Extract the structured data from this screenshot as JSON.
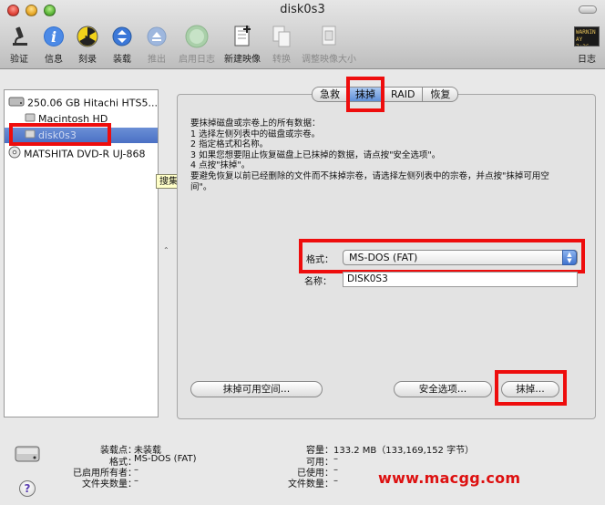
{
  "window": {
    "title": "disk0s3"
  },
  "toolbar": {
    "items": [
      {
        "label": "验证",
        "icon": "microscope-icon",
        "enabled": true
      },
      {
        "label": "信息",
        "icon": "info-icon",
        "enabled": true
      },
      {
        "label": "刻录",
        "icon": "burn-icon",
        "enabled": true
      },
      {
        "label": "装载",
        "icon": "mount-icon",
        "enabled": true
      },
      {
        "label": "推出",
        "icon": "eject-icon",
        "enabled": false
      },
      {
        "label": "启用日志",
        "icon": "journal-icon",
        "enabled": false
      },
      {
        "label": "新建映像",
        "icon": "new-image-icon",
        "enabled": true
      },
      {
        "label": "转换",
        "icon": "convert-icon",
        "enabled": false
      },
      {
        "label": "调整映像大小",
        "icon": "resize-image-icon",
        "enabled": false
      }
    ],
    "log": {
      "label": "日志",
      "icon": "log-icon",
      "badge_line1": "WARNIN",
      "badge_line2": "AY 7:36"
    }
  },
  "sidebar": {
    "devices": [
      {
        "label": "250.06 GB Hitachi HTS5...",
        "level": 0,
        "icon": "hard-disk-icon"
      },
      {
        "label": "Macintosh HD",
        "level": 1,
        "icon": "volume-icon"
      },
      {
        "label": "disk0s3",
        "level": 1,
        "icon": "volume-icon",
        "selected": true
      },
      {
        "label": "MATSHITA DVD-R UJ-868",
        "level": 0,
        "icon": "optical-drive-icon"
      }
    ]
  },
  "tooltip": "搜集有关磁盘或设备的额外信息",
  "tabs": [
    {
      "label": "急救"
    },
    {
      "label": "抹掉",
      "active": true
    },
    {
      "label": "RAID"
    },
    {
      "label": "恢复"
    }
  ],
  "erase": {
    "instructions": [
      "要抹掉磁盘或宗卷上的所有数据：",
      "1 选择左侧列表中的磁盘或宗卷。",
      "2 指定格式和名称。",
      "3 如果您想要阻止恢复磁盘上已抹掉的数据，请点按\"安全选项\"。",
      "4 点按\"抹掉\"。",
      "要避免恢复以前已经删除的文件而不抹掉宗卷，请选择左侧列表中的宗卷，并点按\"抹掉可用空",
      "间\"。"
    ],
    "format_label": "格式：",
    "format_value": "MS-DOS (FAT)",
    "name_label": "名称：",
    "name_value": "DISK0S3",
    "erase_free_space_button": "抹掉可用空间…",
    "security_options_button": "安全选项…",
    "erase_button": "抹掉…"
  },
  "info": {
    "mount_point_label": "装载点：",
    "mount_point_value": "未装载",
    "format_label": "格式：",
    "format_value": "MS-DOS (FAT)",
    "owners_label": "已启用所有者：",
    "owners_value": "–",
    "folders_label": "文件夹数量：",
    "folders_value": "–",
    "capacity_label": "容量：",
    "capacity_value": "133.2 MB（133,169,152 字节）",
    "available_label": "可用：",
    "available_value": "–",
    "used_label": "已使用：",
    "used_value": "–",
    "files_label": "文件数量：",
    "files_value": "–"
  },
  "watermark": "www.macgg.com",
  "colors": {
    "highlight": "#ee0d0d",
    "selection": "#4a70c4",
    "tab_active": "#5f8fd8",
    "watermark": "#dd1111"
  }
}
